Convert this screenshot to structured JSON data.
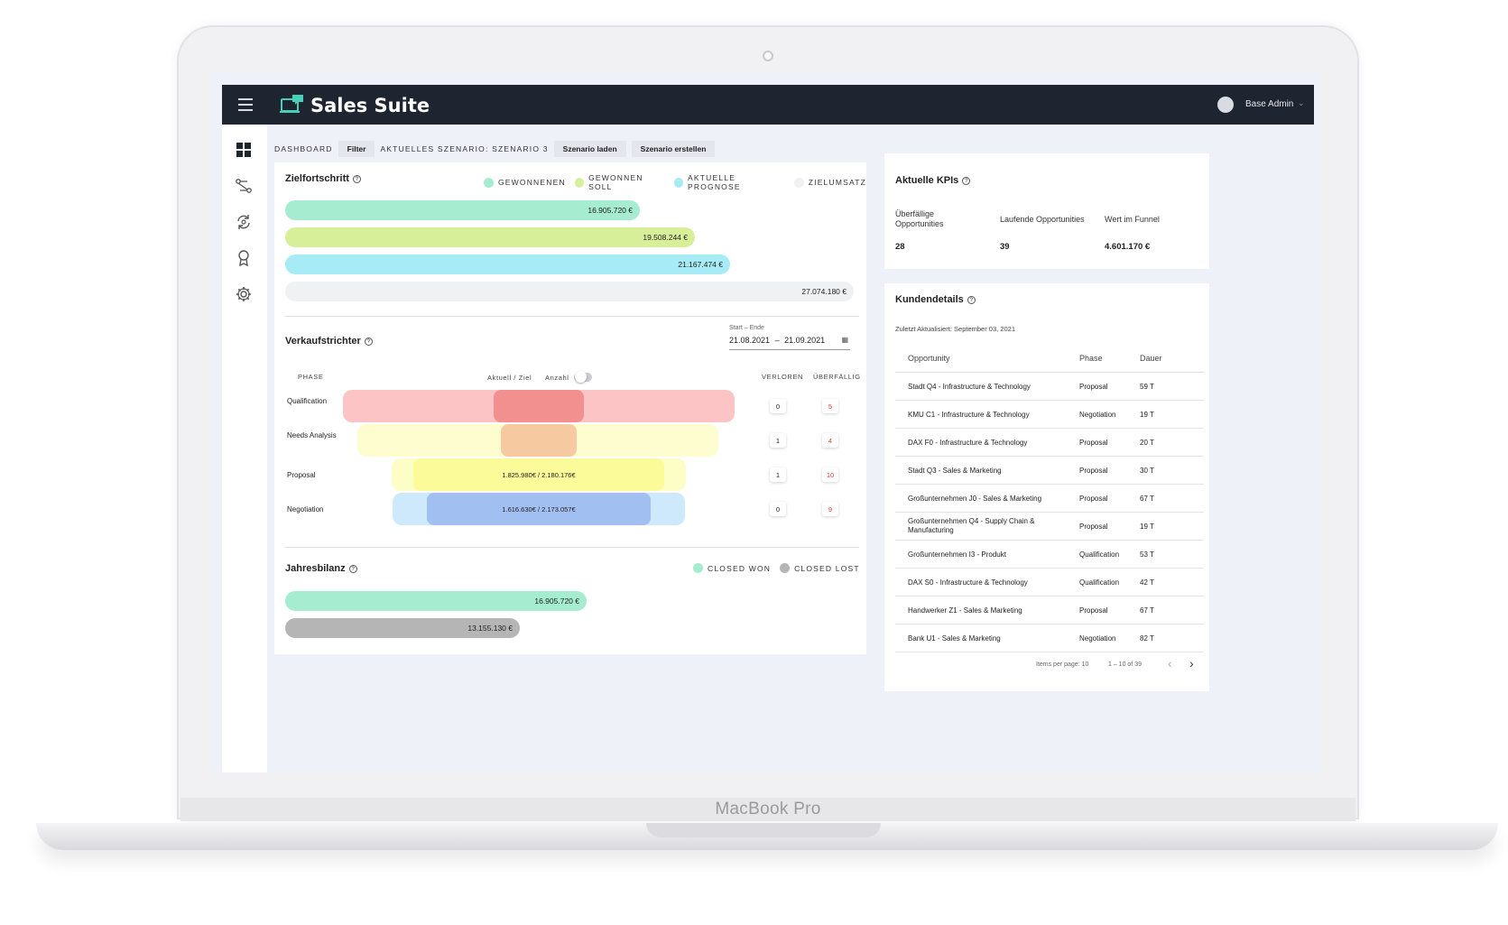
{
  "device": {
    "brand_label": "MacBook Pro"
  },
  "header": {
    "app_title": "Sales Suite",
    "user_name": "Base Admin"
  },
  "toolbar": {
    "dashboard_label": "DASHBOARD",
    "filter_label": "Filter",
    "scenario_label": "AKTUELLES SZENARIO: SZENARIO 3",
    "load_scenario_label": "Szenario laden",
    "create_scenario_label": "Szenario erstellen"
  },
  "ziel": {
    "title": "Zielfortschritt",
    "legend": [
      {
        "label": "GEWONNENEN",
        "color": "#a5ecd0"
      },
      {
        "label": "GEWONNEN SOLL",
        "color": "#d8ef9a"
      },
      {
        "label": "AKTUELLE PROGNOSE",
        "color": "#a6ebf5"
      },
      {
        "label": "ZIELUMSATZ",
        "color": "#f0f1f3"
      }
    ],
    "bars": [
      {
        "label": "16.905.720 €",
        "value": 16905720,
        "color": "#a5ecd0"
      },
      {
        "label": "19.508.244 €",
        "value": 19508244,
        "color": "#d8ef9a"
      },
      {
        "label": "21.167.474 €",
        "value": 21167474,
        "color": "#a6ebf5"
      },
      {
        "label": "27.074.180 €",
        "value": 27074180,
        "color": "#f0f1f3"
      }
    ]
  },
  "funnel": {
    "title": "Verkaufstrichter",
    "date_range_label": "Start – Ende",
    "start_date": "21.08.2021",
    "end_date": "21.09.2021",
    "date_separator": "–",
    "phase_header": "PHASE",
    "toggle_label": "Aktuell / Ziel",
    "toggle_right_label": "Anzahl",
    "lost_header": "VERLOREN",
    "overdue_header": "ÜBERFÄLLIG",
    "rows": [
      {
        "phase": "Qualification",
        "value_label": "",
        "lost": "0",
        "overdue": "5",
        "outer_color": "#fcc4c4",
        "inner_color": "#f28f8f"
      },
      {
        "phase": "Needs Analysis",
        "value_label": "",
        "lost": "1",
        "overdue": "4",
        "outer_color": "#fdfdcf",
        "inner_color": "#f6c9a0"
      },
      {
        "phase": "Proposal",
        "value_label": "1.825.980€ / 2.180.176€",
        "lost": "1",
        "overdue": "10",
        "outer_color": "#fdfdc6",
        "inner_color": "#fcfb9a"
      },
      {
        "phase": "Negotiation",
        "value_label": "1.616.630€ / 2.173.057€",
        "lost": "0",
        "overdue": "9",
        "outer_color": "#cde9fb",
        "inner_color": "#a2bff2"
      }
    ]
  },
  "jahres": {
    "title": "Jahresbilanz",
    "legend": [
      {
        "label": "CLOSED WON",
        "color": "#a5ecd0"
      },
      {
        "label": "CLOSED LOST",
        "color": "#b5b5b5"
      }
    ],
    "bars": [
      {
        "label": "16.905.720 €",
        "value": 16905720,
        "color": "#a5ecd0"
      },
      {
        "label": "13.155.130 €",
        "value": 13155130,
        "color": "#b5b5b5"
      }
    ]
  },
  "kpis": {
    "title": "Aktuelle KPIs",
    "items": [
      {
        "label": "Überfällige Opportunities",
        "value": "28"
      },
      {
        "label": "Laufende Opportunities",
        "value": "39"
      },
      {
        "label": "Wert im Funnel",
        "value": "4.601.170 €"
      }
    ]
  },
  "kunden": {
    "title": "Kundendetails",
    "updated": "Zuletzt Aktualisiert: September 03, 2021",
    "columns": [
      "Opportunity",
      "Phase",
      "Dauer"
    ],
    "rows": [
      {
        "opportunity": "Stadt Q4 - Infrastructure & Technology",
        "phase": "Proposal",
        "dauer": "59 T"
      },
      {
        "opportunity": "KMU C1 - Infrastructure & Technology",
        "phase": "Negotiation",
        "dauer": "19 T"
      },
      {
        "opportunity": "DAX F0 - Infrastructure & Technology",
        "phase": "Proposal",
        "dauer": "20 T"
      },
      {
        "opportunity": "Stadt Q3 - Sales & Marketing",
        "phase": "Proposal",
        "dauer": "30 T"
      },
      {
        "opportunity": "Großunternehmen J0 - Sales & Marketing",
        "phase": "Proposal",
        "dauer": "67 T"
      },
      {
        "opportunity": "Großunternehmen Q4 - Supply Chain & Manufacturing",
        "phase": "Proposal",
        "dauer": "19 T"
      },
      {
        "opportunity": "Großunternehmen I3 - Produkt",
        "phase": "Qualification",
        "dauer": "53 T"
      },
      {
        "opportunity": "DAX S0 - Infrastructure & Technology",
        "phase": "Qualification",
        "dauer": "42 T"
      },
      {
        "opportunity": "Handwerker Z1 - Sales & Marketing",
        "phase": "Proposal",
        "dauer": "67 T"
      },
      {
        "opportunity": "Bank U1 - Sales & Marketing",
        "phase": "Negotiation",
        "dauer": "82 T"
      }
    ],
    "items_per_page": "Items per page: 10",
    "range": "1 – 10 of 39",
    "prev": "‹",
    "next": "›"
  }
}
